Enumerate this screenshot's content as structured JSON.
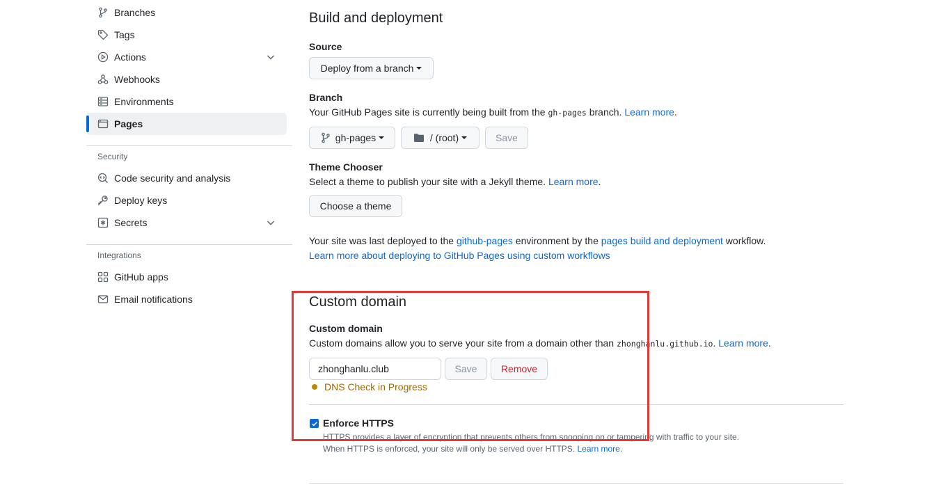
{
  "sidebar": {
    "items": [
      {
        "label": "Branches",
        "icon": "git-branch-icon"
      },
      {
        "label": "Tags",
        "icon": "tag-icon"
      },
      {
        "label": "Actions",
        "icon": "play-icon"
      },
      {
        "label": "Webhooks",
        "icon": "webhook-icon"
      },
      {
        "label": "Environments",
        "icon": "server-icon"
      },
      {
        "label": "Pages",
        "icon": "browser-icon"
      }
    ],
    "security_title": "Security",
    "security_items": [
      {
        "label": "Code security and analysis",
        "icon": "codescan-icon"
      },
      {
        "label": "Deploy keys",
        "icon": "key-icon"
      },
      {
        "label": "Secrets",
        "icon": "key-asterisk-icon"
      }
    ],
    "integrations_title": "Integrations",
    "integrations_items": [
      {
        "label": "GitHub apps",
        "icon": "apps-icon"
      },
      {
        "label": "Email notifications",
        "icon": "mail-icon"
      }
    ]
  },
  "build": {
    "title": "Build and deployment",
    "source_label": "Source",
    "source_value": "Deploy from a branch",
    "branch_label": "Branch",
    "branch_desc_pre": "Your GitHub Pages site is currently being built from the",
    "branch_desc_code": "gh-pages",
    "branch_desc_post": "branch.",
    "learn_more": "Learn more",
    "branch_value": "gh-pages",
    "folder_value": "/ (root)",
    "save_label": "Save",
    "theme_label": "Theme Chooser",
    "theme_desc": "Select a theme to publish your site with a Jekyll theme.",
    "theme_button": "Choose a theme",
    "deployed_pre": "Your site was last deployed to the",
    "deployed_env": "github-pages",
    "deployed_mid": "environment by the",
    "deployed_workflow": "pages build and deployment",
    "deployed_post": "workflow.",
    "custom_workflows_link": "Learn more about deploying to GitHub Pages using custom workflows"
  },
  "custom_domain": {
    "title": "Custom domain",
    "label": "Custom domain",
    "desc_pre": "Custom domains allow you to serve your site from a domain other than",
    "desc_code": "zhonghanlu.github.io",
    "desc_post": ".",
    "learn_more": "Learn more",
    "input_value": "zhonghanlu.club",
    "save_label": "Save",
    "remove_label": "Remove",
    "status": "DNS Check in Progress",
    "status_color": "#bf8700"
  },
  "https": {
    "label": "Enforce HTTPS",
    "checked": true,
    "note1": "HTTPS provides a layer of encryption that prevents others from snooping on or tampering with traffic to your site.",
    "note2": "When HTTPS is enforced, your site will only be served over HTTPS.",
    "learn_more": "Learn more."
  },
  "colors": {
    "accent": "#0969da",
    "highlight": "#e03a3a",
    "danger": "#cf222e"
  }
}
